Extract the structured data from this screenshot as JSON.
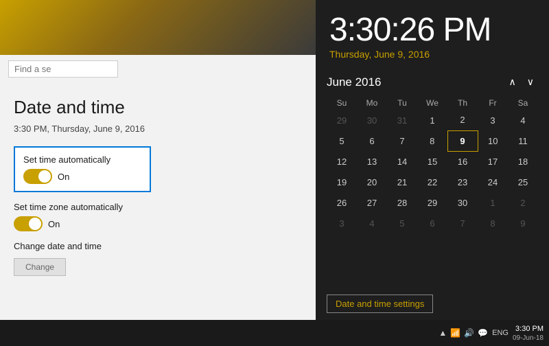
{
  "desktop": {
    "background_gradient": "linear-gradient(135deg, #c8a000 0%, #8b6914 40%, #3a3a3a 100%)"
  },
  "settings": {
    "title": "Date and time",
    "current_time_label": "3:30 PM, Thursday, June 9, 2016",
    "search_placeholder": "Find a se",
    "set_time_auto": {
      "label": "Set time automatically",
      "value": "On",
      "enabled": true
    },
    "set_timezone_auto": {
      "label": "Set time zone automatically",
      "value": "On",
      "enabled": true
    },
    "change_section": {
      "label": "Change date and time",
      "button_label": "Change"
    }
  },
  "calendar": {
    "time": "3:30:26 PM",
    "date_label": "Thursday, June 9, 2016",
    "month_year": "June 2016",
    "nav_up": "∧",
    "nav_down": "∨",
    "weekdays": [
      "Su",
      "Mo",
      "Tu",
      "We",
      "Th",
      "Fr",
      "Sa"
    ],
    "rows": [
      [
        "29",
        "30",
        "31",
        "1",
        "2",
        "3",
        "4"
      ],
      [
        "5",
        "6",
        "7",
        "8",
        "9",
        "10",
        "11"
      ],
      [
        "12",
        "13",
        "14",
        "15",
        "16",
        "17",
        "18"
      ],
      [
        "19",
        "20",
        "21",
        "22",
        "23",
        "24",
        "25"
      ],
      [
        "26",
        "27",
        "28",
        "29",
        "30",
        "1",
        "2"
      ],
      [
        "3",
        "4",
        "5",
        "6",
        "7",
        "8",
        "9"
      ]
    ],
    "row_types": [
      [
        "other",
        "other",
        "other",
        "normal",
        "normal",
        "normal",
        "normal"
      ],
      [
        "normal",
        "normal",
        "normal",
        "normal",
        "today",
        "normal",
        "normal"
      ],
      [
        "normal",
        "normal",
        "normal",
        "normal",
        "normal",
        "normal",
        "normal"
      ],
      [
        "normal",
        "normal",
        "normal",
        "normal",
        "normal",
        "normal",
        "normal"
      ],
      [
        "normal",
        "normal",
        "normal",
        "normal",
        "normal",
        "other",
        "other"
      ],
      [
        "other",
        "other",
        "other",
        "other",
        "other",
        "other",
        "other"
      ]
    ],
    "today_index": {
      "row": 1,
      "col": 4
    },
    "settings_link": "Date and time settings"
  },
  "taskbar": {
    "time": "3:30 PM",
    "date": "09-Jun-18",
    "lang": "ENG",
    "icons": [
      "▲",
      "🔊",
      "📶",
      "💬"
    ]
  }
}
